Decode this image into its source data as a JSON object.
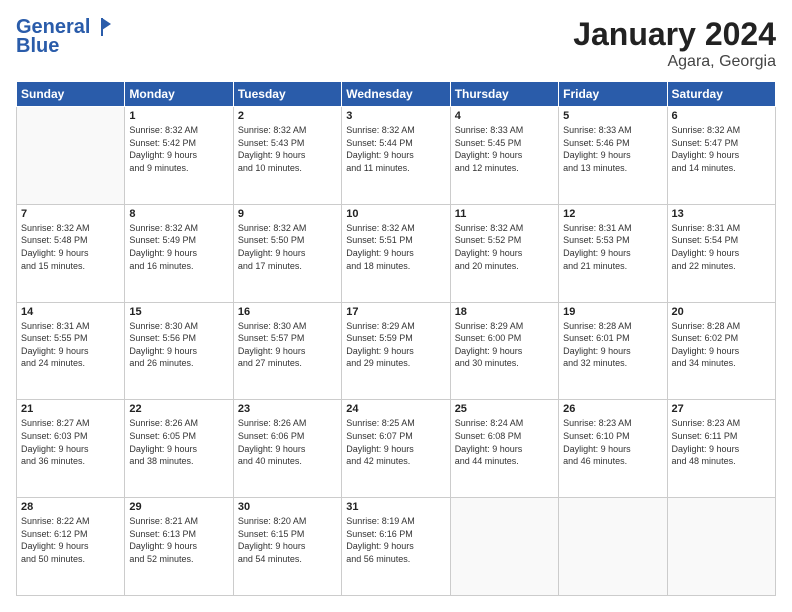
{
  "header": {
    "logo_general": "General",
    "logo_blue": "Blue",
    "month_title": "January 2024",
    "location": "Agara, Georgia"
  },
  "days_of_week": [
    "Sunday",
    "Monday",
    "Tuesday",
    "Wednesday",
    "Thursday",
    "Friday",
    "Saturday"
  ],
  "weeks": [
    [
      {
        "day": "",
        "content": ""
      },
      {
        "day": "1",
        "content": "Sunrise: 8:32 AM\nSunset: 5:42 PM\nDaylight: 9 hours\nand 9 minutes."
      },
      {
        "day": "2",
        "content": "Sunrise: 8:32 AM\nSunset: 5:43 PM\nDaylight: 9 hours\nand 10 minutes."
      },
      {
        "day": "3",
        "content": "Sunrise: 8:32 AM\nSunset: 5:44 PM\nDaylight: 9 hours\nand 11 minutes."
      },
      {
        "day": "4",
        "content": "Sunrise: 8:33 AM\nSunset: 5:45 PM\nDaylight: 9 hours\nand 12 minutes."
      },
      {
        "day": "5",
        "content": "Sunrise: 8:33 AM\nSunset: 5:46 PM\nDaylight: 9 hours\nand 13 minutes."
      },
      {
        "day": "6",
        "content": "Sunrise: 8:32 AM\nSunset: 5:47 PM\nDaylight: 9 hours\nand 14 minutes."
      }
    ],
    [
      {
        "day": "7",
        "content": "Sunrise: 8:32 AM\nSunset: 5:48 PM\nDaylight: 9 hours\nand 15 minutes."
      },
      {
        "day": "8",
        "content": "Sunrise: 8:32 AM\nSunset: 5:49 PM\nDaylight: 9 hours\nand 16 minutes."
      },
      {
        "day": "9",
        "content": "Sunrise: 8:32 AM\nSunset: 5:50 PM\nDaylight: 9 hours\nand 17 minutes."
      },
      {
        "day": "10",
        "content": "Sunrise: 8:32 AM\nSunset: 5:51 PM\nDaylight: 9 hours\nand 18 minutes."
      },
      {
        "day": "11",
        "content": "Sunrise: 8:32 AM\nSunset: 5:52 PM\nDaylight: 9 hours\nand 20 minutes."
      },
      {
        "day": "12",
        "content": "Sunrise: 8:31 AM\nSunset: 5:53 PM\nDaylight: 9 hours\nand 21 minutes."
      },
      {
        "day": "13",
        "content": "Sunrise: 8:31 AM\nSunset: 5:54 PM\nDaylight: 9 hours\nand 22 minutes."
      }
    ],
    [
      {
        "day": "14",
        "content": "Sunrise: 8:31 AM\nSunset: 5:55 PM\nDaylight: 9 hours\nand 24 minutes."
      },
      {
        "day": "15",
        "content": "Sunrise: 8:30 AM\nSunset: 5:56 PM\nDaylight: 9 hours\nand 26 minutes."
      },
      {
        "day": "16",
        "content": "Sunrise: 8:30 AM\nSunset: 5:57 PM\nDaylight: 9 hours\nand 27 minutes."
      },
      {
        "day": "17",
        "content": "Sunrise: 8:29 AM\nSunset: 5:59 PM\nDaylight: 9 hours\nand 29 minutes."
      },
      {
        "day": "18",
        "content": "Sunrise: 8:29 AM\nSunset: 6:00 PM\nDaylight: 9 hours\nand 30 minutes."
      },
      {
        "day": "19",
        "content": "Sunrise: 8:28 AM\nSunset: 6:01 PM\nDaylight: 9 hours\nand 32 minutes."
      },
      {
        "day": "20",
        "content": "Sunrise: 8:28 AM\nSunset: 6:02 PM\nDaylight: 9 hours\nand 34 minutes."
      }
    ],
    [
      {
        "day": "21",
        "content": "Sunrise: 8:27 AM\nSunset: 6:03 PM\nDaylight: 9 hours\nand 36 minutes."
      },
      {
        "day": "22",
        "content": "Sunrise: 8:26 AM\nSunset: 6:05 PM\nDaylight: 9 hours\nand 38 minutes."
      },
      {
        "day": "23",
        "content": "Sunrise: 8:26 AM\nSunset: 6:06 PM\nDaylight: 9 hours\nand 40 minutes."
      },
      {
        "day": "24",
        "content": "Sunrise: 8:25 AM\nSunset: 6:07 PM\nDaylight: 9 hours\nand 42 minutes."
      },
      {
        "day": "25",
        "content": "Sunrise: 8:24 AM\nSunset: 6:08 PM\nDaylight: 9 hours\nand 44 minutes."
      },
      {
        "day": "26",
        "content": "Sunrise: 8:23 AM\nSunset: 6:10 PM\nDaylight: 9 hours\nand 46 minutes."
      },
      {
        "day": "27",
        "content": "Sunrise: 8:23 AM\nSunset: 6:11 PM\nDaylight: 9 hours\nand 48 minutes."
      }
    ],
    [
      {
        "day": "28",
        "content": "Sunrise: 8:22 AM\nSunset: 6:12 PM\nDaylight: 9 hours\nand 50 minutes."
      },
      {
        "day": "29",
        "content": "Sunrise: 8:21 AM\nSunset: 6:13 PM\nDaylight: 9 hours\nand 52 minutes."
      },
      {
        "day": "30",
        "content": "Sunrise: 8:20 AM\nSunset: 6:15 PM\nDaylight: 9 hours\nand 54 minutes."
      },
      {
        "day": "31",
        "content": "Sunrise: 8:19 AM\nSunset: 6:16 PM\nDaylight: 9 hours\nand 56 minutes."
      },
      {
        "day": "",
        "content": ""
      },
      {
        "day": "",
        "content": ""
      },
      {
        "day": "",
        "content": ""
      }
    ]
  ]
}
